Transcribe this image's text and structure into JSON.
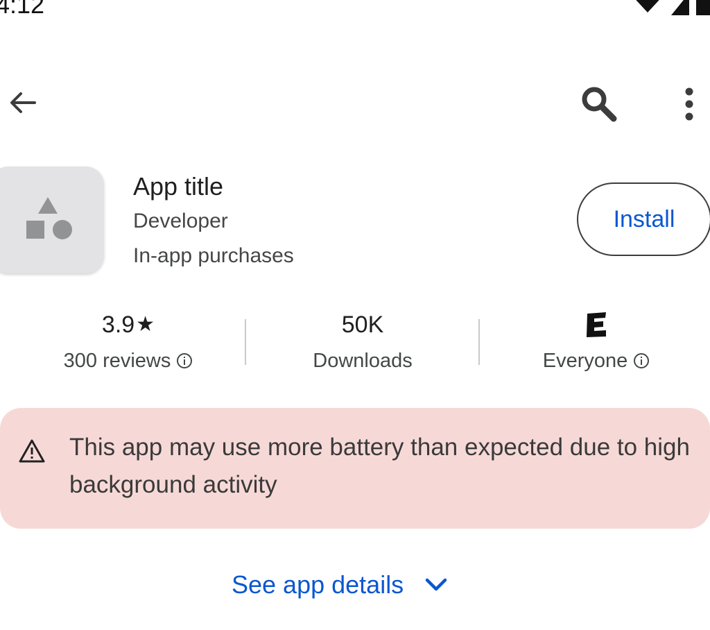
{
  "status_bar": {
    "time": "4:12"
  },
  "top_bar": {
    "icons": [
      "arrow-back-icon",
      "search-icon",
      "more-vert-icon"
    ]
  },
  "app": {
    "title": "App title",
    "developer": "Developer",
    "purchases": "In-app purchases",
    "install_label": "Install"
  },
  "stats": {
    "rating_value": "3.9",
    "reviews_label": "300 reviews",
    "downloads_value": "50K",
    "downloads_label": "Downloads",
    "content_rating_symbol": "E",
    "content_rating_label": "Everyone"
  },
  "warning": {
    "text": "This app may use more battery than expected due to high background activity"
  },
  "details": {
    "label": "See app details"
  },
  "colors": {
    "accent": "#0b57d0",
    "warning_bg": "#f6d9d7",
    "icon_bg": "#e3e3e6"
  }
}
